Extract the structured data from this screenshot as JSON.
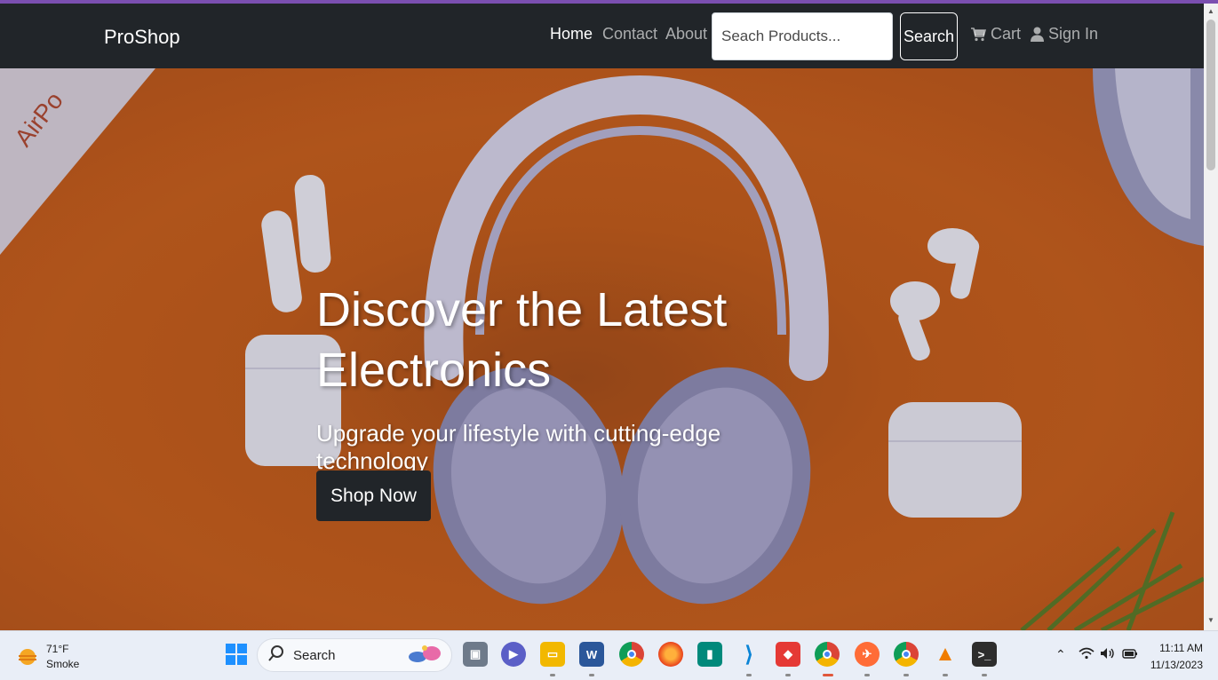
{
  "nav": {
    "brand": "ProShop",
    "links": {
      "home": "Home",
      "contact": "Contact",
      "about": "About"
    },
    "search_placeholder": "Seach Products...",
    "search_button": "Search",
    "cart": "Cart",
    "sign_in": "Sign In"
  },
  "hero": {
    "title_line1": "Discover the Latest",
    "title_line2": "Electronics",
    "subtitle": "Upgrade your lifestyle with cutting-edge technology",
    "cta": "Shop Now",
    "box_label": "AirPo"
  },
  "taskbar": {
    "weather_temp": "71°F",
    "weather_desc": "Smoke",
    "search_label": "Search",
    "time": "11:11 AM",
    "date": "11/13/2023",
    "apps": [
      "windows-start",
      "task-view",
      "teams",
      "file-explorer",
      "word",
      "chrome",
      "firefox",
      "meet",
      "vscode",
      "anydesk",
      "chrome-profile",
      "postman",
      "chrome-profile-n",
      "vlc",
      "terminal"
    ]
  },
  "colors": {
    "navbar": "#212529",
    "hero_orange": "#c8601f",
    "accent_bar": "#7b4fb0",
    "taskbar": "#e9eef7"
  }
}
